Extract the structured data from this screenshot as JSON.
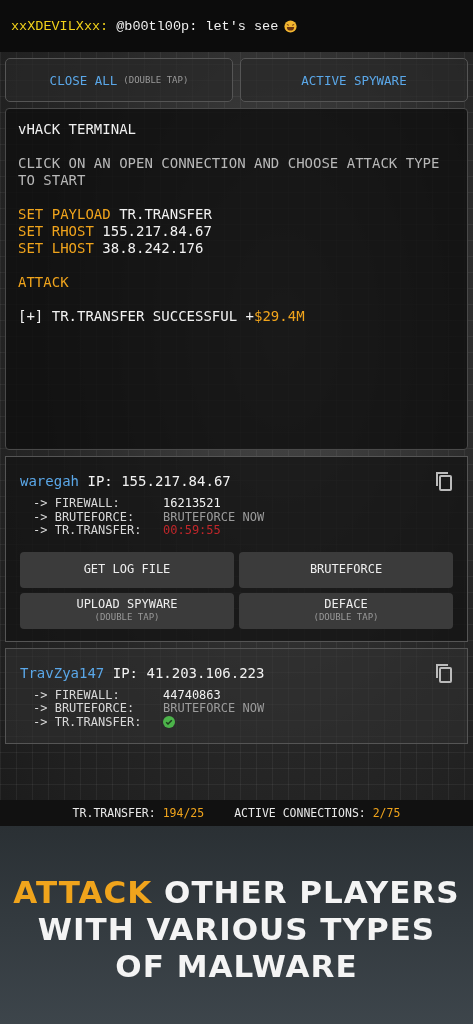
{
  "chat": {
    "user": "xxXDEVILXxx:",
    "message": "@b00tl00p: let's see",
    "emoji": true
  },
  "top_buttons": [
    {
      "label": "CLOSE ALL",
      "hint": "(DOUBLE TAP)"
    },
    {
      "label": "ACTIVE SPYWARE"
    }
  ],
  "terminal": {
    "title": "vHACK TERMINAL",
    "lines": [
      {
        "kind": "blank"
      },
      {
        "kind": "info",
        "parts": [
          {
            "text": "CLICK ON AN OPEN CONNECTION AND CHOOSE ATTACK TYPE TO START",
            "highlight": false
          }
        ]
      },
      {
        "kind": "blank"
      },
      {
        "kind": "text",
        "parts": [
          {
            "text": "SET PAYLOAD ",
            "highlight": true
          },
          {
            "text": "TR.TRANSFER",
            "highlight": false
          }
        ]
      },
      {
        "kind": "text",
        "parts": [
          {
            "text": "SET RHOST ",
            "highlight": true
          },
          {
            "text": "155.217.84.67",
            "highlight": false
          }
        ]
      },
      {
        "kind": "text",
        "parts": [
          {
            "text": "SET LHOST ",
            "highlight": true
          },
          {
            "text": "38.8.242.176",
            "highlight": false
          }
        ]
      },
      {
        "kind": "blank"
      },
      {
        "kind": "text",
        "parts": [
          {
            "text": "ATTACK",
            "highlight": true
          }
        ]
      },
      {
        "kind": "blank"
      },
      {
        "kind": "text",
        "parts": [
          {
            "text": "[+] TR.TRANSFER SUCCESSFUL +",
            "highlight": false
          },
          {
            "text": "$29.4M",
            "highlight": true
          }
        ]
      }
    ]
  },
  "connections": [
    {
      "user": "waregah",
      "ip_label": "IP:",
      "ip": "155.217.84.67",
      "expanded": true,
      "stats": [
        {
          "label": "-> FIREWALL:",
          "kind": "number",
          "value": "16213521"
        },
        {
          "label": "-> BRUTEFORCE:",
          "kind": "action",
          "value": "BRUTEFORCE NOW"
        },
        {
          "label": "-> TR.TRANSFER:",
          "kind": "timer",
          "value": "00:59:55"
        }
      ],
      "actions": [
        {
          "label": "GET LOG FILE"
        },
        {
          "label": "BRUTEFORCE"
        },
        {
          "label": "UPLOAD SPYWARE",
          "hint": "(DOUBLE TAP)"
        },
        {
          "label": "DEFACE",
          "hint": "(DOUBLE TAP)"
        }
      ]
    },
    {
      "user": "TravZya147",
      "ip_label": "IP:",
      "ip": "41.203.106.223",
      "expanded": false,
      "stats": [
        {
          "label": "-> FIREWALL:",
          "kind": "number",
          "value": "44740863"
        },
        {
          "label": "-> BRUTEFORCE:",
          "kind": "action",
          "value": "BRUTEFORCE NOW"
        },
        {
          "label": "-> TR.TRANSFER:",
          "kind": "done"
        }
      ]
    }
  ],
  "status_bar": [
    {
      "label": "TR.TRANSFER:",
      "value": "194/25"
    },
    {
      "label": "ACTIVE CONNECTIONS:",
      "value": "2/75"
    }
  ],
  "caption": [
    [
      {
        "text": "ATTACK",
        "highlight": true
      },
      {
        "text": " OTHER PLAYERS",
        "highlight": false
      }
    ],
    [
      {
        "text": "WITH VARIOUS TYPES",
        "highlight": false
      }
    ],
    [
      {
        "text": "OF MALWARE",
        "highlight": false
      }
    ]
  ]
}
